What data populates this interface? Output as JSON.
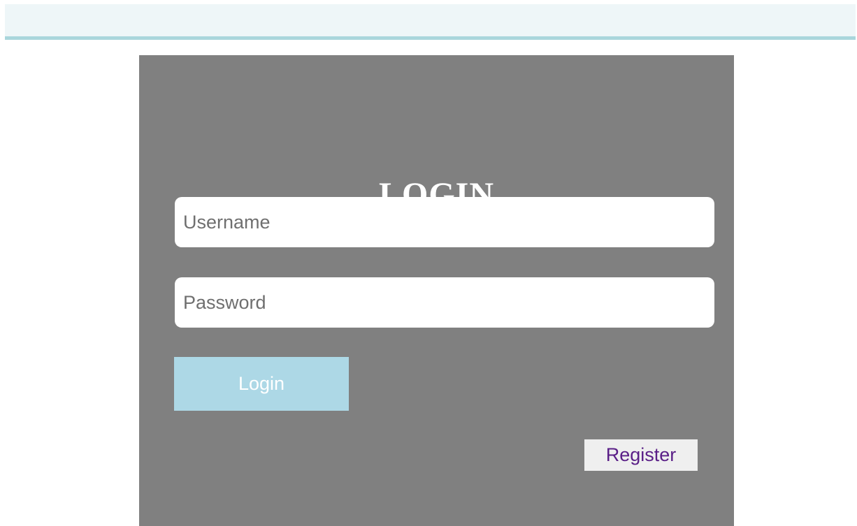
{
  "header": {
    "background_color": "#eef6f8",
    "border_color": "#a9d6dc"
  },
  "login": {
    "title": "LOGIN",
    "panel_color": "#808080",
    "username_placeholder": "Username",
    "username_value": "",
    "password_placeholder": "Password",
    "password_value": "",
    "login_button_label": "Login",
    "login_button_color": "#add8e6",
    "register_button_label": "Register",
    "register_text_color": "#5a1f87"
  }
}
